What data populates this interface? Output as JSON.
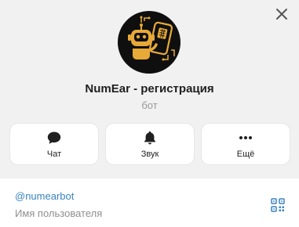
{
  "profile": {
    "name": "NumEar - регистрация",
    "type": "бот",
    "avatar_icon": "robot-with-phone-logo",
    "accent_color": "#e7a938"
  },
  "actions": [
    {
      "label": "Чат",
      "icon": "chat-bubble-icon"
    },
    {
      "label": "Звук",
      "icon": "bell-icon"
    },
    {
      "label": "Ещё",
      "icon": "more-dots-icon"
    }
  ],
  "info": {
    "username": "@numearbot",
    "username_caption": "Имя пользователя",
    "qr_icon": "qr-code-icon"
  },
  "window": {
    "close_icon": "close-icon"
  }
}
